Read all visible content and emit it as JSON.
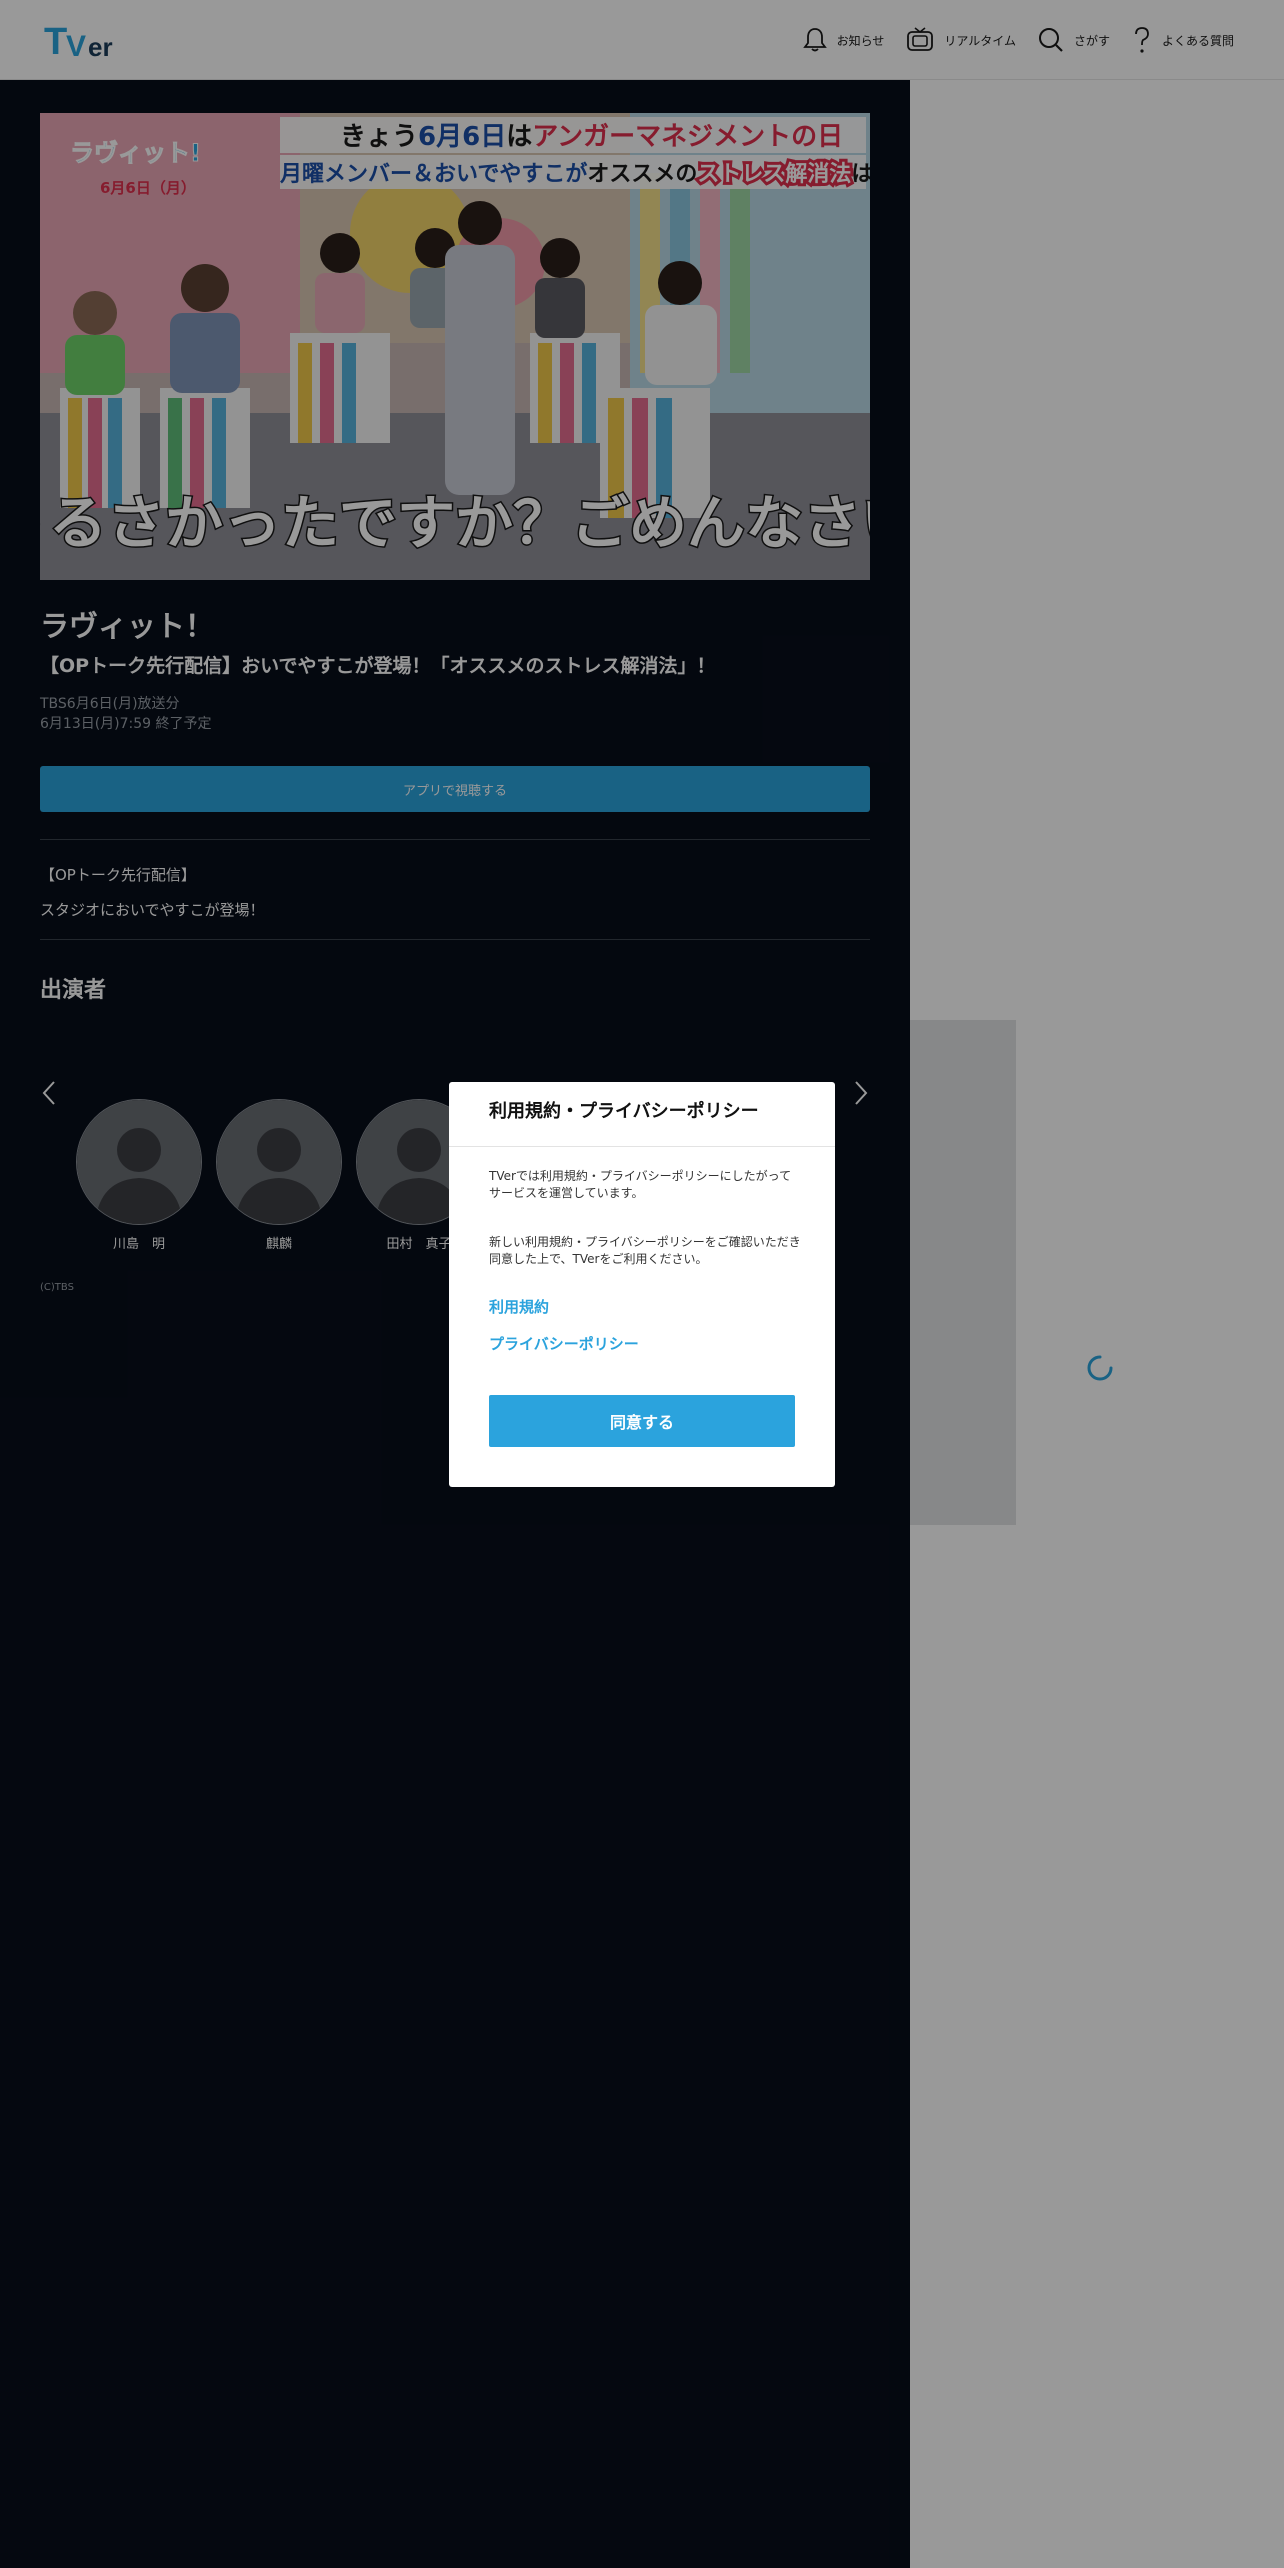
{
  "header": {
    "logo_alt": "TVer",
    "nav": [
      {
        "label": "お知らせ",
        "icon": "bell-icon"
      },
      {
        "label": "リアルタイム",
        "icon": "tv-icon"
      },
      {
        "label": "さがす",
        "icon": "search-icon"
      },
      {
        "label": "よくある質問",
        "icon": "question-icon"
      }
    ]
  },
  "episode": {
    "series_title": "ラヴィット！",
    "episode_title": "【OPトーク先行配信】おいでやすこが登場！「オススメのストレス解消法」！",
    "broadcast": "TBS6月6日(月)放送分",
    "expire": "6月13日(月)7:59 終了予定",
    "app_button": "アプリで視聴する",
    "description_line1": "【OPトーク先行配信】",
    "description_line2": "スタジオにおいでやすこが登場！"
  },
  "thumbnail": {
    "banner_line1_part1": "きょう",
    "banner_line1_part2": "6月6日",
    "banner_line1_part3": "は",
    "banner_line1_part4": "アンガーマネジメントの日",
    "banner_line2_part1": "月曜メンバー＆おいでやすこが",
    "banner_line2_part2": "オススメの",
    "banner_line2_part3": "ストレス解消法",
    "banner_line2_part4": "は?",
    "logo_text": "ラヴィット!",
    "date_text": "6月6日（月）",
    "caption": "うるさかったですか？ごめんなさい"
  },
  "cast": {
    "heading": "出演者",
    "members": [
      {
        "name": "川島　明"
      },
      {
        "name": "麒麟"
      },
      {
        "name": "田村　真子"
      },
      {
        "name": ""
      },
      {
        "name": ""
      },
      {
        "name": ""
      }
    ]
  },
  "copyright": "(C)TBS",
  "modal": {
    "title": "利用規約・プライバシーポリシー",
    "text1": "TVerでは利用規約・プライバシーポリシーにしたがってサービスを運営しています。",
    "text2": "新しい利用規約・プライバシーポリシーをご確認いただき同意した上で、TVerをご利用ください。",
    "link_terms": "利用規約",
    "link_privacy": "プライバシーポリシー",
    "agree_button": "同意する"
  },
  "colors": {
    "accent": "#2ba3dd",
    "dark_bg": "#080e1a",
    "logo_blue": "#2ba3dd",
    "logo_dark": "#1c3d5a"
  }
}
